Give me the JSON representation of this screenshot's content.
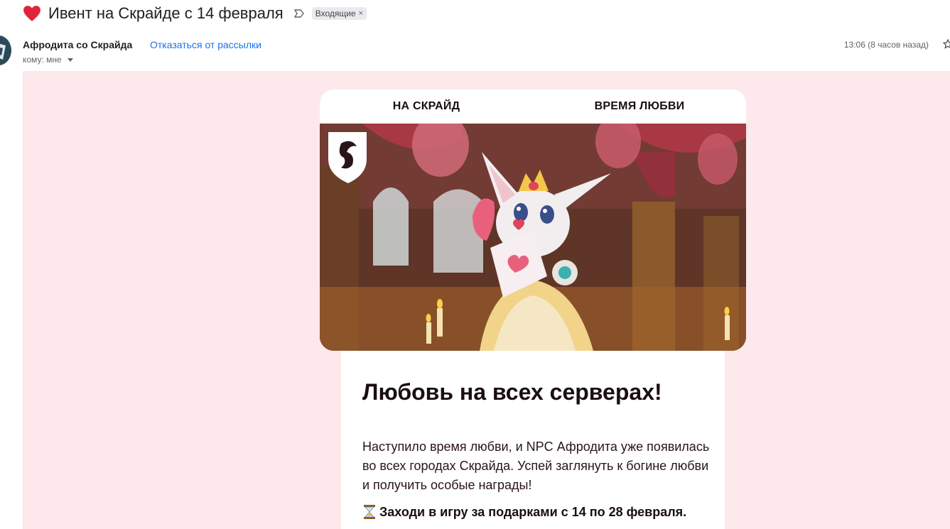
{
  "email": {
    "subject": "Ивент на Скрайде с 14 февраля",
    "label": "Входящие",
    "label_remove": "×",
    "sender": "Афродита со Скрайда",
    "unsubscribe": "Отказаться от рассылки",
    "to": "кому: мне",
    "time": "13:06 (8 часов назад)"
  },
  "newsletter": {
    "nav": [
      "НА СКРАЙД",
      "ВРЕМЯ ЛЮБВИ"
    ],
    "headline": "Любовь на всех серверах!",
    "paragraph": "Наступило время любви, и NPC Афродита уже появилась во всех городах Скрайда. Успей заглянуть к богине любви и получить особые награды!",
    "cta": "Заходи в игру за подарками с 14 по 28 февраля."
  },
  "colors": {
    "email_bg": "#fde8ec",
    "link": "#1a73e8",
    "heart": "#e0243a"
  },
  "icons": {
    "subject_prefix": "heart-icon",
    "importance": "importance-marker-icon",
    "cta_prefix": "hourglass-icon",
    "logo": "dragon-shield-logo"
  }
}
